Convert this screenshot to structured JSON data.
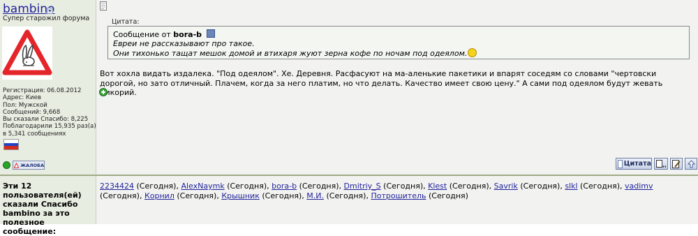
{
  "user": {
    "name": "bambino",
    "title": "Супер старожил форума",
    "info": [
      "Регистрация: 06.08.2012",
      "Адрес: Киев",
      "Пол: Мужской",
      "Сообщений: 9,668",
      "Вы сказали Спасибо: 8,225",
      "Поблагодарили 15,935 раз(а)",
      "в 5,341 сообщениях"
    ],
    "flag_colors": [
      "#ffffff",
      "#1f44c8",
      "#d52b1e"
    ],
    "report_label": "ЖАЛОБА",
    "online_icon": "online-dot-icon",
    "avatar_icon": "warning-rabbit-sign-icon"
  },
  "post": {
    "quote_label": "Цитата:",
    "quote_header_prefix": "Сообщение от",
    "quote_author": "bora-b",
    "quote_line1": "Евреи не рассказывают про такое.",
    "quote_line2": "Они тихонько тащат мешок домой и втихаря жуют зерна кофе по ночам под одеялом.",
    "body": "Вот хохла видать издалека. \"Под одеялом\". Хе. Деревня. Расфасуют на ма-аленькие пакетики и впарят соседям со словами \"чертовски дорогой, но зато отличный. Плачем, когда за него платим, но что делать. Качество имеет свою цену.\" А сами под одеялом будут жевать цикорий."
  },
  "buttons": {
    "quote": "Цитата",
    "multi_quote_icon": "multi-quote-icon",
    "edit_icon": "edit-icon",
    "top_icon": "arrow-up-icon"
  },
  "thanks": {
    "label": "Эти 12 пользователя(ей) сказали Спасибо bambino за это полезное сообщение:",
    "users": [
      {
        "name": "2234424",
        "when": "(Сегодня),"
      },
      {
        "name": "AlexNaymk",
        "when": "(Сегодня),"
      },
      {
        "name": "bora-b",
        "when": "(Сегодня),"
      },
      {
        "name": "Dmitriy_S",
        "when": "(Сегодня),"
      },
      {
        "name": "Klest",
        "when": "(Сегодня),"
      },
      {
        "name": "Savrik",
        "when": "(Сегодня),"
      },
      {
        "name": "slkl",
        "when": "(Сегодня),"
      },
      {
        "name": "vadimv",
        "when": "(Сегодня),"
      },
      {
        "name": "Корнил",
        "when": "(Сегодня),"
      },
      {
        "name": "Крышник",
        "when": "(Сегодня),"
      },
      {
        "name": "М.И.",
        "when": "(Сегодня),"
      },
      {
        "name": "Потрошитель",
        "when": "(Сегодня)"
      }
    ]
  }
}
